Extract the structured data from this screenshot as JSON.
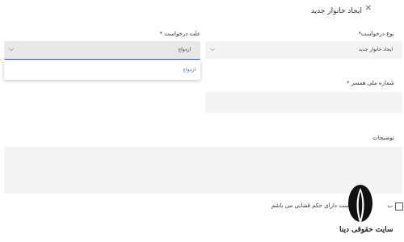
{
  "header": {
    "title": "ایجاد خانوار جدید",
    "close_icon": "close-icon"
  },
  "form": {
    "request_type": {
      "label": "نوع درخواست*",
      "value": "ایجاد خانوار جدید"
    },
    "request_reason": {
      "label": "علت درخواست *",
      "value": "ازدواج",
      "options": [
        "ازدواج"
      ]
    },
    "spouse_national_id": {
      "label": "شماره ملی همسر *",
      "value": ""
    },
    "notes": {
      "label": "توضیحات",
      "value": ""
    },
    "court_order_checkbox": {
      "label_visible": "ست دارای حکم قضایی می باشم",
      "label_prefix": "ب",
      "checked": false
    }
  },
  "watermark": {
    "site_name": "سایت حقوقی دینا"
  },
  "colors": {
    "accent": "#3b5bd6",
    "field_bg": "#f4f4f4"
  }
}
